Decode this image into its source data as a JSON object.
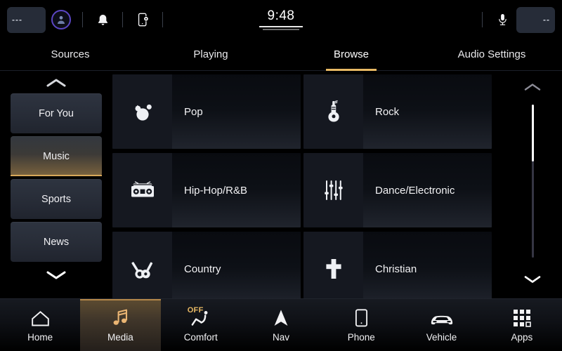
{
  "status_bar": {
    "left_plate_text": "---",
    "right_plate_text": "--",
    "avatar_name": "driver-profile-avatar",
    "notification_icon": "bell-icon",
    "phone_settings_icon": "phone-gear-icon",
    "mic_icon": "microphone-icon",
    "clock": "9:48"
  },
  "tabs": [
    {
      "label": "Sources",
      "active": false
    },
    {
      "label": "Playing",
      "active": false
    },
    {
      "label": "Browse",
      "active": true
    },
    {
      "label": "Audio Settings",
      "active": false
    }
  ],
  "sidebar": {
    "scroll_up_icon": "chevron-up-icon",
    "scroll_down_icon": "chevron-down-icon",
    "items": [
      {
        "label": "For You",
        "selected": false
      },
      {
        "label": "Music",
        "selected": true
      },
      {
        "label": "Sports",
        "selected": false
      },
      {
        "label": "News",
        "selected": false
      }
    ]
  },
  "browse_list": {
    "items": [
      {
        "label": "Pop",
        "icon": "balloons-icon"
      },
      {
        "label": "Rock",
        "icon": "electric-guitar-icon"
      },
      {
        "label": "Hip-Hop/R&B",
        "icon": "boombox-icon"
      },
      {
        "label": "Dance/Electronic",
        "icon": "equalizer-sliders-icon"
      },
      {
        "label": "Country",
        "icon": "banjo-guitar-icon"
      },
      {
        "label": "Christian",
        "icon": "cross-icon"
      }
    ]
  },
  "scrollbar": {
    "up_icon": "chevron-up-icon",
    "down_icon": "chevron-down-icon",
    "thumb_position_percent": 0,
    "thumb_size_percent": 37
  },
  "bottom_nav": [
    {
      "label": "Home",
      "icon": "home-icon",
      "active": false,
      "badge": ""
    },
    {
      "label": "Media",
      "icon": "music-note-icon",
      "active": true,
      "badge": ""
    },
    {
      "label": "Comfort",
      "icon": "seat-icon",
      "active": false,
      "badge": "OFF"
    },
    {
      "label": "Nav",
      "icon": "navigation-arrow-icon",
      "active": false,
      "badge": ""
    },
    {
      "label": "Phone",
      "icon": "smartphone-icon",
      "active": false,
      "badge": ""
    },
    {
      "label": "Vehicle",
      "icon": "car-icon",
      "active": false,
      "badge": ""
    },
    {
      "label": "Apps",
      "icon": "apps-grid-icon",
      "active": false,
      "badge": ""
    }
  ],
  "colors": {
    "accent_gold": "#e8b964",
    "accent_gold_dim": "#d7a759",
    "background": "#000000",
    "tile_icon_bg": "#151820",
    "sidebar_button": "#2e3440",
    "avatar_ring": "#5b46c4"
  }
}
